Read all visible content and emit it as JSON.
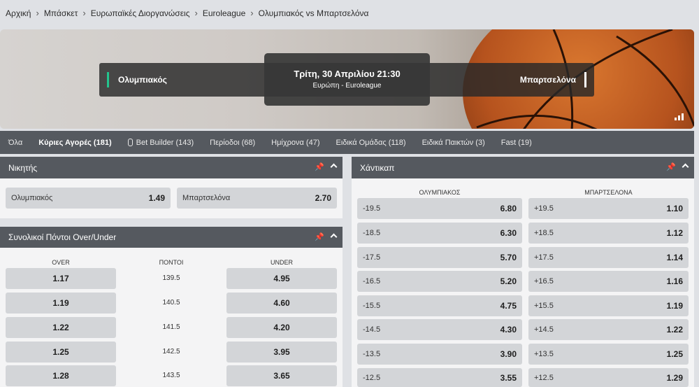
{
  "breadcrumb": [
    "Αρχική",
    "Μπάσκετ",
    "Ευρωπαϊκές Διοργανώσεις",
    "Euroleague",
    "Ολυμπιακός vs Μπαρτσελόνα"
  ],
  "match": {
    "home_team": "Ολυμπιακός",
    "away_team": "Μπαρτσελόνα",
    "date": "Τρίτη, 30 Απριλίου 21:30",
    "competition": "Ευρώπη - Euroleague"
  },
  "tabs": [
    {
      "label": "Όλα"
    },
    {
      "label": "Κύριες Αγορές (181)",
      "active": true
    },
    {
      "label": "Bet Builder (143)"
    },
    {
      "label": "Περίοδοι (68)"
    },
    {
      "label": "Ημίχρονα (47)"
    },
    {
      "label": "Ειδικά Ομάδας (118)"
    },
    {
      "label": "Ειδικά Παικτών (3)"
    },
    {
      "label": "Fast (19)"
    }
  ],
  "winner": {
    "title": "Νικητής",
    "options": [
      {
        "label": "Ολυμπιακός",
        "odd": "1.49"
      },
      {
        "label": "Μπαρτσελόνα",
        "odd": "2.70"
      }
    ]
  },
  "totals": {
    "title": "Συνολικοί Πόντοι Over/Under",
    "headers": {
      "over": "OVER",
      "points": "ΠΟΝΤΟΙ",
      "under": "UNDER"
    },
    "rows": [
      {
        "over": "1.17",
        "points": "139.5",
        "under": "4.95"
      },
      {
        "over": "1.19",
        "points": "140.5",
        "under": "4.60"
      },
      {
        "over": "1.22",
        "points": "141.5",
        "under": "4.20"
      },
      {
        "over": "1.25",
        "points": "142.5",
        "under": "3.95"
      },
      {
        "over": "1.28",
        "points": "143.5",
        "under": "3.65"
      }
    ]
  },
  "handicap": {
    "title": "Χάντικαπ",
    "headers": {
      "home": "ΟΛΥΜΠΙΑΚΟΣ",
      "away": "ΜΠΑΡΤΣΕΛΟΝΑ"
    },
    "rows": [
      {
        "home_line": "-19.5",
        "home_odd": "6.80",
        "away_line": "+19.5",
        "away_odd": "1.10"
      },
      {
        "home_line": "-18.5",
        "home_odd": "6.30",
        "away_line": "+18.5",
        "away_odd": "1.12"
      },
      {
        "home_line": "-17.5",
        "home_odd": "5.70",
        "away_line": "+17.5",
        "away_odd": "1.14"
      },
      {
        "home_line": "-16.5",
        "home_odd": "5.20",
        "away_line": "+16.5",
        "away_odd": "1.16"
      },
      {
        "home_line": "-15.5",
        "home_odd": "4.75",
        "away_line": "+15.5",
        "away_odd": "1.19"
      },
      {
        "home_line": "-14.5",
        "home_odd": "4.30",
        "away_line": "+14.5",
        "away_odd": "1.22"
      },
      {
        "home_line": "-13.5",
        "home_odd": "3.90",
        "away_line": "+13.5",
        "away_odd": "1.25"
      },
      {
        "home_line": "-12.5",
        "home_odd": "3.55",
        "away_line": "+12.5",
        "away_odd": "1.29"
      }
    ]
  },
  "icons": {
    "pin": "pin-icon",
    "collapse": "chevron-up-icon",
    "stats": "stats-icon"
  },
  "colors": {
    "accent_green": "#23c48e",
    "header_bg": "#55595f",
    "pin_yellow": "#f2b51c"
  }
}
